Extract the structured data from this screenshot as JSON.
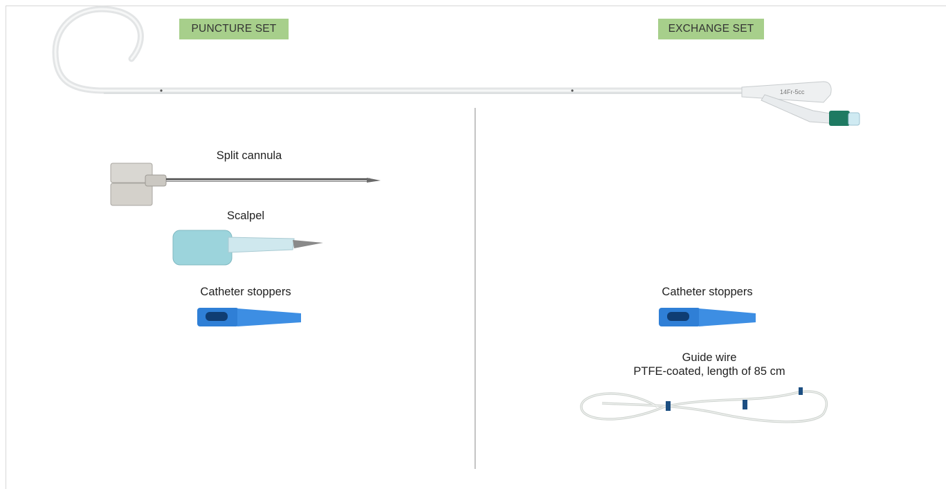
{
  "sets": {
    "puncture_label": "PUNCTURE SET",
    "exchange_label": "EXCHANGE SET"
  },
  "catheter": {
    "marking": "14Fr-5cc"
  },
  "puncture_items": {
    "split_cannula": "Split cannula",
    "scalpel": "Scalpel",
    "catheter_stoppers": "Catheter stoppers"
  },
  "exchange_items": {
    "catheter_stoppers": "Catheter stoppers",
    "guide_wire_title": "Guide wire",
    "guide_wire_desc": "PTFE-coated, length of 85 cm"
  },
  "colors": {
    "label_bg": "#a7cf8b",
    "stopper_blue": "#2f7fd6",
    "connector_green": "#1e7a62",
    "band_blue": "#1d4f82"
  }
}
